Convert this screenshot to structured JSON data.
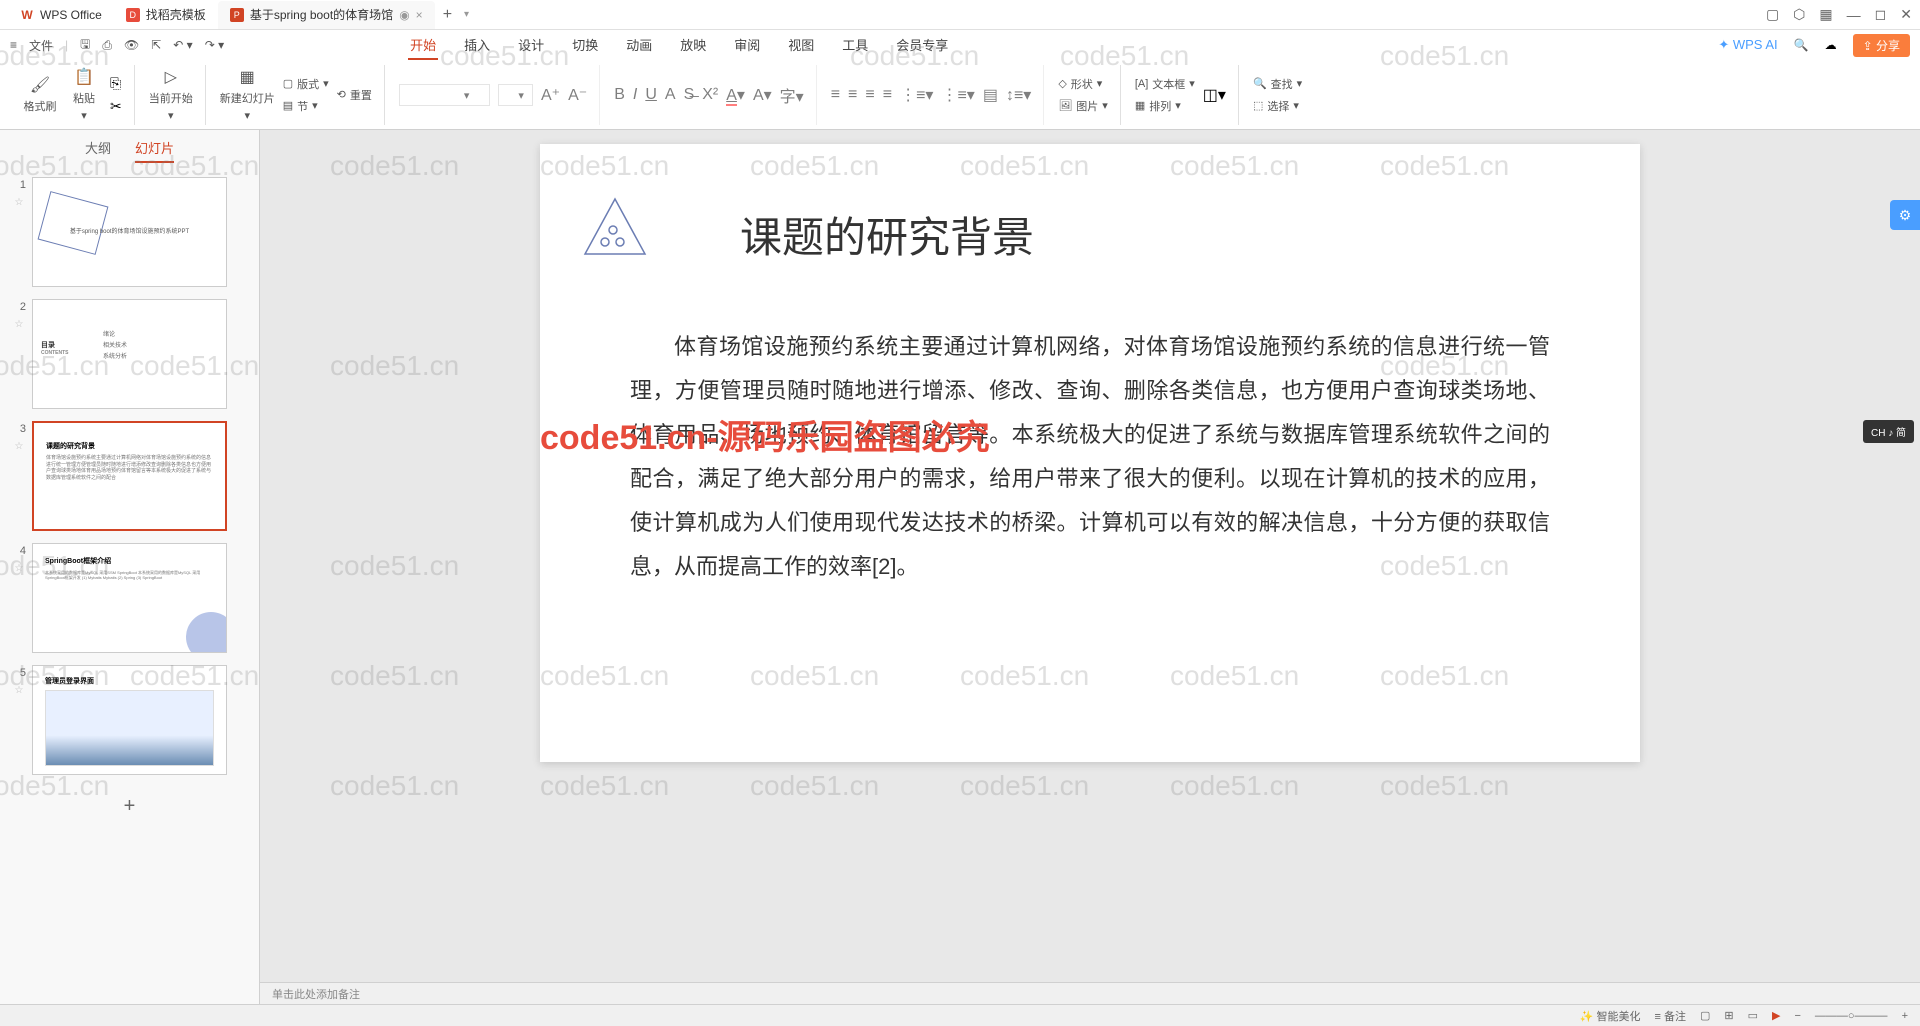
{
  "titlebar": {
    "tab1": "WPS Office",
    "tab2": "找稻壳模板",
    "tab3": "基于spring boot的体育场馆",
    "close": "×",
    "add": "+"
  },
  "menubar": {
    "menu_icon": "≡",
    "file": "文件",
    "ribbon": {
      "start": "开始",
      "insert": "插入",
      "design": "设计",
      "transition": "切换",
      "animation": "动画",
      "slideshow": "放映",
      "review": "审阅",
      "view": "视图",
      "tools": "工具",
      "member": "会员专享"
    },
    "wps_ai": "WPS AI",
    "share": "分享"
  },
  "toolbar": {
    "format_painter": "格式刷",
    "paste": "粘贴",
    "from_current": "当前开始",
    "new_slide": "新建幻灯片",
    "layout": "版式",
    "section": "节",
    "reset": "重置",
    "shape": "形状",
    "picture": "图片",
    "textbox": "文本框",
    "arrange": "排列",
    "find": "查找",
    "select": "选择"
  },
  "panel": {
    "outline": "大纲",
    "slides": "幻灯片"
  },
  "thumbs": {
    "t1_text": "基于spring boot的体育场馆设施预约系统PPT",
    "t2_title": "目录",
    "t2_contents": "CONTENTS",
    "t2_i1": "绪论",
    "t2_i2": "相关技术",
    "t2_i3": "系统分析",
    "t3_title": "课题的研究背景",
    "t4_title": "SpringBoot框架介绍",
    "t5_title": "管理员登录界面",
    "add": "+"
  },
  "slide": {
    "title": "课题的研究背景",
    "body": "体育场馆设施预约系统主要通过计算机网络，对体育场馆设施预约系统的信息进行统一管理，方便管理员随时随地进行增添、修改、查询、删除各类信息，也方便用户查询球类场地、体育用品、场地预约、体育馆留言等。本系统极大的促进了系统与数据库管理系统软件之间的配合，满足了绝大部分用户的需求，给用户带来了很大的便利。以现在计算机的技术的应用，使计算机成为人们使用现代发达技术的桥梁。计算机可以有效的解决信息，十分方便的获取信息，从而提高工作的效率[2]。"
  },
  "notes": "单击此处添加备注",
  "watermark": "code51.cn",
  "watermark_red": "code51.cn-源码乐园盗图必究",
  "ime": "CH ♪ 简",
  "status": {
    "smart_beautify": "智能美化",
    "notes_btn": "备注"
  }
}
